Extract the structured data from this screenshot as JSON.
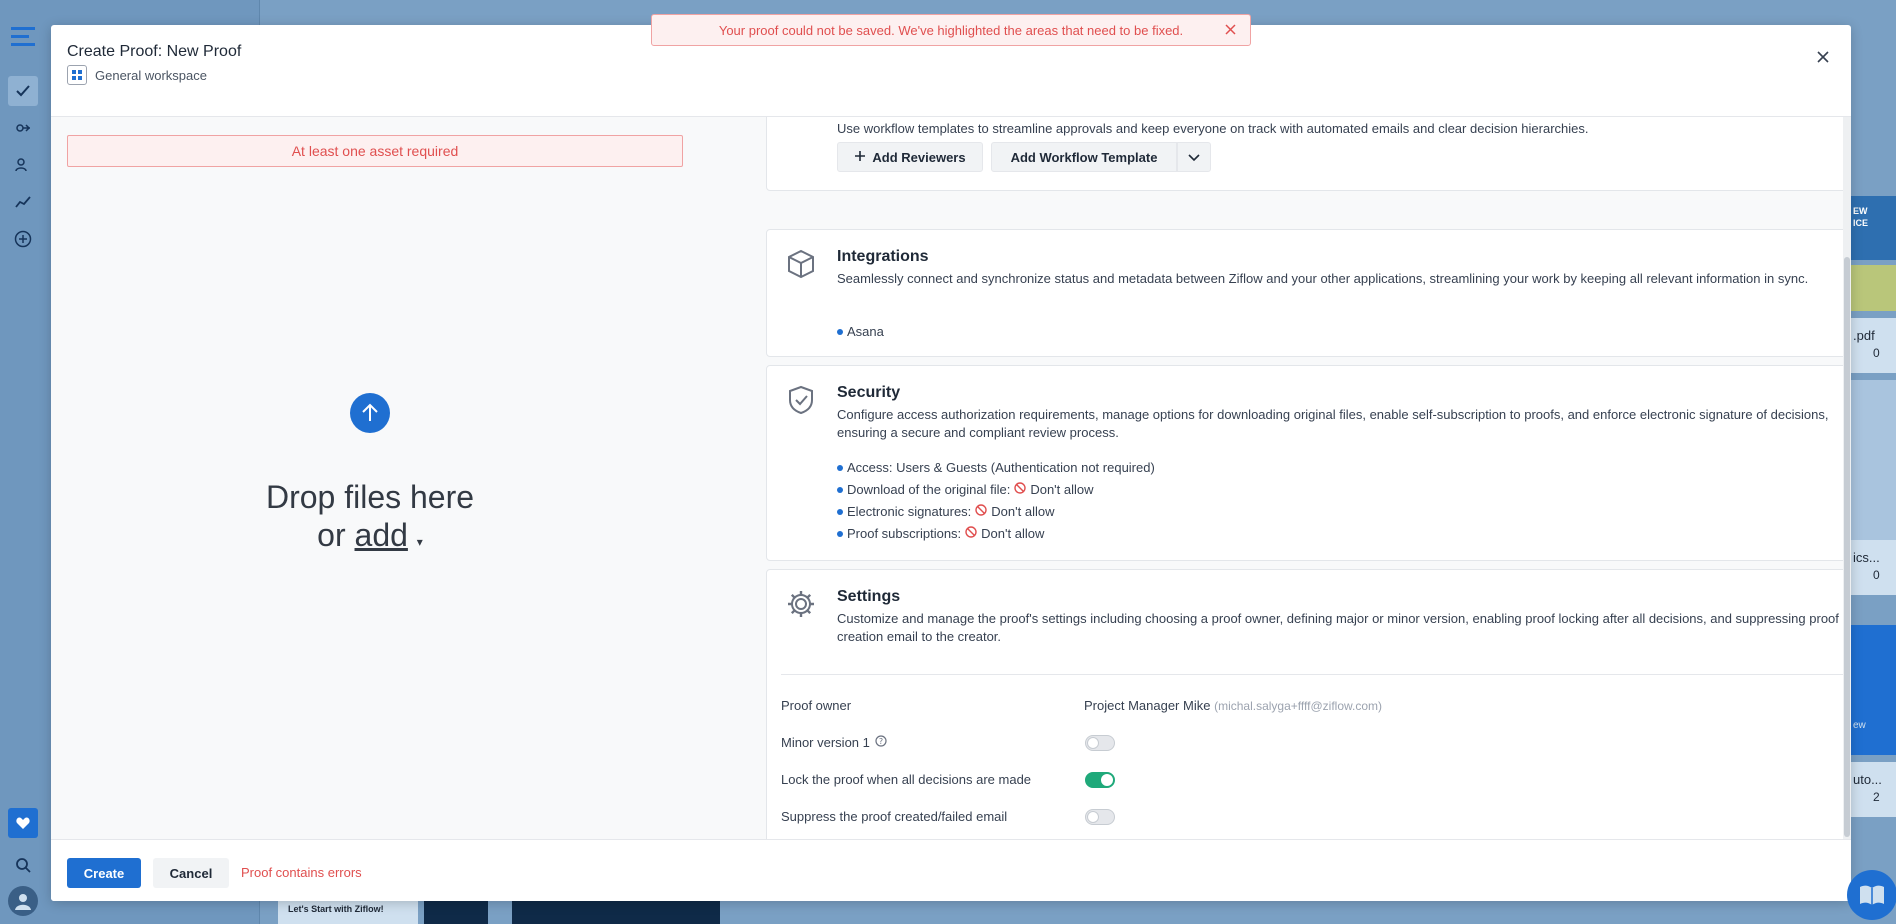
{
  "toast": {
    "message": "Your proof could not be saved. We've highlighted the areas that need to be fixed."
  },
  "modal": {
    "title": "Create Proof:  New Proof",
    "workspace": "General workspace"
  },
  "left": {
    "asset_error": "At least one asset required",
    "drop_line1": "Drop files here",
    "drop_or": "or",
    "drop_add": "add"
  },
  "workflow": {
    "desc": "Use workflow templates to streamline approvals and keep everyone on track with automated emails and clear decision hierarchies.",
    "add_reviewers": "Add Reviewers",
    "add_template": "Add Workflow Template"
  },
  "integrations": {
    "title": "Integrations",
    "desc": "Seamlessly connect and synchronize status and metadata between Ziflow and your other applications, streamlining your work by keeping all relevant information in sync.",
    "items": [
      "Asana"
    ]
  },
  "security": {
    "title": "Security",
    "desc": "Configure access authorization requirements, manage options for downloading original files, enable self-subscription to proofs, and enforce electronic signature of decisions, ensuring a secure and compliant review process.",
    "access": "Access: Users & Guests (Authentication not required)",
    "download_label": "Download of the original file:",
    "esign_label": "Electronic signatures:",
    "subs_label": "Proof subscriptions:",
    "deny_text": "Don't allow"
  },
  "settings": {
    "title": "Settings",
    "desc": "Customize and manage the proof's settings including choosing a proof owner, defining major or minor version, enabling proof locking after all decisions, and suppressing proof creation email to the creator.",
    "owner_label": "Proof owner",
    "owner_name": "Project Manager Mike",
    "owner_email": "(michal.salyga+ffff@ziflow.com)",
    "minor_label": "Minor version 1",
    "lock_label": "Lock the proof when all decisions are made",
    "suppress_label": "Suppress the proof created/failed email",
    "minor_on": false,
    "lock_on": true,
    "suppress_on": false
  },
  "footer": {
    "create": "Create",
    "cancel": "Cancel",
    "error": "Proof contains errors"
  },
  "background": {
    "card_texts": [
      "Let's Start with Ziflow!",
      ".pdf",
      "0",
      "ics...",
      "0",
      "uto...",
      "2",
      "ew",
      "EW",
      "ICE"
    ]
  }
}
